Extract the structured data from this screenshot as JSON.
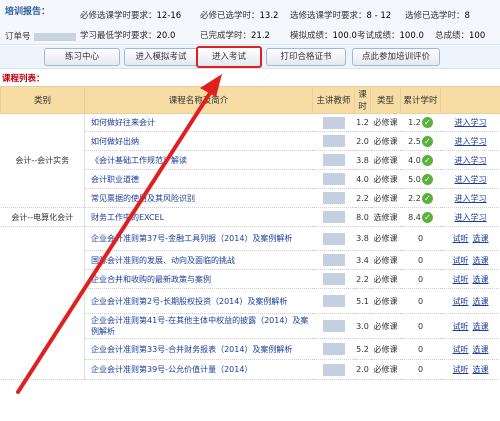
{
  "report": {
    "label": "培训报告：",
    "order_label": "订单号",
    "stats_row1": [
      {
        "label": "必修选课学时要求：",
        "value": "12-16"
      },
      {
        "label": "必修已选学时：",
        "value": "13.2"
      },
      {
        "label": "选修选课学时要求：",
        "value": "8 - 12"
      },
      {
        "label": "选修已选学时：",
        "value": "8"
      }
    ],
    "stats_row2": [
      {
        "label": "学习最低学时要求：",
        "value": "20.0"
      },
      {
        "label": "已完成学时：",
        "value": "21.2"
      },
      {
        "label": "模拟成绩：",
        "value": "100.0"
      },
      {
        "label": "考试成绩：",
        "value": "100.0"
      },
      {
        "label": "总成绩：",
        "value": "100"
      }
    ]
  },
  "buttons": [
    "练习中心",
    "进入模拟考试",
    "进入考试",
    "打印合格证书",
    "点此参加培训评价"
  ],
  "course_list_label": "课程列表：",
  "table": {
    "headers": [
      "类别",
      "课程名称及简介",
      "主讲教师",
      "课时",
      "类型",
      "累计学时",
      ""
    ],
    "groups": [
      {
        "category": "会计--会计实务",
        "rows": [
          {
            "name": "如何做好往来会计",
            "hours": "1.2",
            "type": "必修课",
            "done": "1.2",
            "check": true,
            "actions": [
              "进入学习"
            ]
          },
          {
            "name": "如何做好出纳",
            "hours": "2.0",
            "type": "必修课",
            "done": "2.5",
            "check": true,
            "actions": [
              "进入学习"
            ]
          },
          {
            "name": "《会计基础工作规范》解读",
            "hours": "3.8",
            "type": "必修课",
            "done": "4.0",
            "check": true,
            "actions": [
              "进入学习"
            ]
          },
          {
            "name": "会计职业道德",
            "hours": "4.0",
            "type": "必修课",
            "done": "5.0",
            "check": true,
            "actions": [
              "进入学习"
            ]
          },
          {
            "name": "常见票据的使用及其风险识别",
            "hours": "2.2",
            "type": "必修课",
            "done": "2.2",
            "check": true,
            "actions": [
              "进入学习"
            ]
          }
        ]
      },
      {
        "category": "会计--电算化会计",
        "rows": [
          {
            "name": "财务工作中的EXCEL",
            "hours": "8.0",
            "type": "选修课",
            "done": "8.4",
            "check": true,
            "actions": [
              "进入学习"
            ]
          }
        ]
      },
      {
        "category": "",
        "rows": [
          {
            "name": "企业会计准则第37号-金融工具列报（2014）及案例解析",
            "hours": "3.8",
            "type": "必修课",
            "done": "0",
            "check": false,
            "actions": [
              "试听",
              "选课"
            ]
          },
          {
            "name": "国际会计准则的发展、动向及面临的挑战",
            "hours": "3.4",
            "type": "必修课",
            "done": "0",
            "check": false,
            "actions": [
              "试听",
              "选课"
            ]
          },
          {
            "name": "企业合并和收购的最新政策与案例",
            "hours": "2.2",
            "type": "必修课",
            "done": "0",
            "check": false,
            "actions": [
              "试听",
              "选课"
            ]
          },
          {
            "name": "企业会计准则第2号-长期股权投资（2014）及案例解析",
            "hours": "5.1",
            "type": "必修课",
            "done": "0",
            "check": false,
            "actions": [
              "试听",
              "选课"
            ]
          },
          {
            "name": "企业会计准则第41号-在其他主体中权益的披露（2014）及案例解析",
            "hours": "3.0",
            "type": "必修课",
            "done": "0",
            "check": false,
            "actions": [
              "试听",
              "选课"
            ]
          },
          {
            "name": "企业会计准则第33号-合并财务报表（2014）及案例解析",
            "hours": "5.2",
            "type": "必修课",
            "done": "0",
            "check": false,
            "actions": [
              "试听",
              "选课"
            ]
          },
          {
            "name": "企业会计准则第39号-公允价值计量（2014）",
            "hours": "2.0",
            "type": "必修课",
            "done": "0",
            "check": false,
            "actions": [
              "试听",
              "选课"
            ]
          }
        ]
      }
    ]
  },
  "colors": {
    "accent_red": "#e02020",
    "header_bg": "#f7dca4",
    "link": "#1b3d9c",
    "check": "#5bb23b"
  },
  "icons": {
    "check": "check-circle-icon"
  }
}
